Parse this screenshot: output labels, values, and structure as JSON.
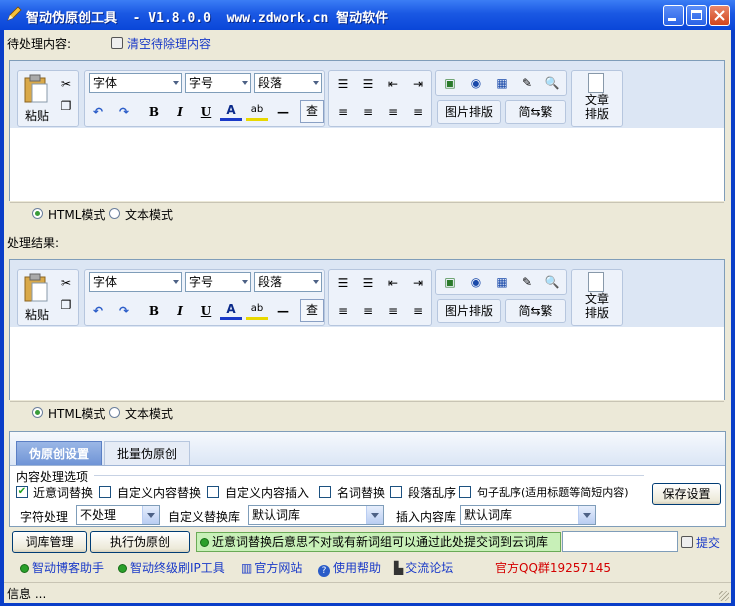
{
  "window": {
    "title": "智动伪原创工具  - V1.8.0.0  www.zdwork.cn 智动软件"
  },
  "colors": {
    "titlebar": "#1a58e3",
    "toolbar": "#dce6f4",
    "link": "#1a3ac8",
    "qq_red": "#d40000"
  },
  "top": {
    "pending_label": "待处理内容:",
    "clear_link": "清空待除理内容"
  },
  "editor": {
    "paste": "粘贴",
    "font": "字体",
    "size": "字号",
    "para": "段落",
    "bold": "B",
    "italic": "I",
    "underline": "U",
    "font_color": "A",
    "highlight": "ab",
    "hr": "—",
    "find": "查",
    "image_layout": "图片排版",
    "simp_trad": "简⇆繁",
    "article_line1": "文章",
    "article_line2": "排版",
    "html_mode": "HTML模式",
    "text_mode": "文本模式"
  },
  "result": {
    "label": "处理结果:"
  },
  "tabs": [
    {
      "label": "伪原创设置"
    },
    {
      "label": "批量伪原创"
    }
  ],
  "options": {
    "group_label": "内容处理选项",
    "near_synonym": "近意词替换",
    "custom_replace": "自定义内容替换",
    "custom_insert": "自定义内容插入",
    "noun_replace": "名词替换",
    "para_shuffle": "段落乱序",
    "sentence_shuffle": "句子乱序(适用标题等简短内容)",
    "save": "保存设置",
    "char_label": "字符处理",
    "char_value": "不处理",
    "custom_lib_label": "自定义替换库",
    "custom_lib_value": "默认词库",
    "insert_lib_label": "插入内容库",
    "insert_lib_value": "默认词库"
  },
  "actions": {
    "lib_manage": "词库管理",
    "execute": "执行伪原创",
    "notice": "近意词替换后意思不对或有新词组可以通过此处提交词到云词库",
    "submit": "提交"
  },
  "links": [
    {
      "label": "智动博客助手"
    },
    {
      "label": "智动终级刷IP工具"
    },
    {
      "label": "官方网站"
    },
    {
      "label": "使用帮助"
    },
    {
      "label": "交流论坛"
    }
  ],
  "qq": "官方QQ群19257145",
  "status": "信息 ..."
}
